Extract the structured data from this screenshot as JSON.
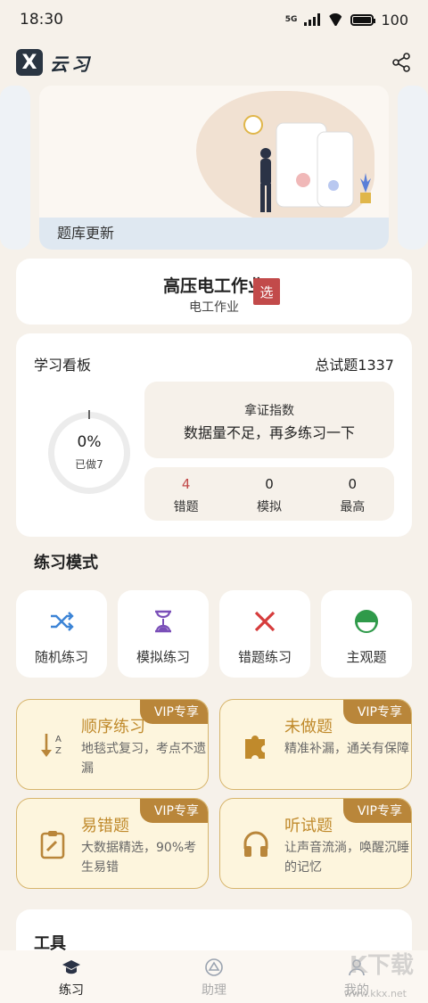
{
  "status_bar": {
    "time": "18:30",
    "network": "5G",
    "battery": "100"
  },
  "header": {
    "brand": "云习",
    "logo_letter": "X",
    "share_icon": "share-icon"
  },
  "banner": {
    "title": "题库更新"
  },
  "course": {
    "title": "高压电工作业",
    "subtitle": "电工作业",
    "select_badge": "选"
  },
  "board": {
    "title": "学习看板",
    "total": "总试题1337",
    "progress_percent": "0%",
    "done": "已做7",
    "index_label": "拿证指数",
    "index_message": "数据量不足，再多练习一下",
    "stats": [
      {
        "value": "4",
        "label": "错题",
        "color": "#c24a4a"
      },
      {
        "value": "0",
        "label": "模拟",
        "color": "#222222"
      },
      {
        "value": "0",
        "label": "最高",
        "color": "#222222"
      }
    ]
  },
  "practice": {
    "title": "练习模式",
    "modes": [
      {
        "label": "随机练习",
        "icon": "shuffle-icon"
      },
      {
        "label": "模拟练习",
        "icon": "hourglass-icon"
      },
      {
        "label": "错题练习",
        "icon": "close-icon"
      },
      {
        "label": "主观题",
        "icon": "half-circle-icon"
      }
    ],
    "vip_cards": [
      {
        "tag": "VIP专享",
        "title": "顺序练习",
        "desc": "地毯式复习，考点不遗漏",
        "icon": "sort-az-icon"
      },
      {
        "tag": "VIP专享",
        "title": "未做题",
        "desc": "精准补漏，通关有保障",
        "icon": "puzzle-icon"
      },
      {
        "tag": "VIP专享",
        "title": "易错题",
        "desc": "大数据精选，90%考生易错",
        "icon": "clipboard-edit-icon"
      },
      {
        "tag": "VIP专享",
        "title": "听试题",
        "desc": "让声音流淌，唤醒沉睡的记忆",
        "icon": "headphones-icon"
      }
    ]
  },
  "tools": {
    "title": "工具"
  },
  "nav": {
    "items": [
      {
        "label": "练习",
        "icon": "graduation-cap-icon",
        "active": true
      },
      {
        "label": "助理",
        "icon": "assistant-icon",
        "active": false
      },
      {
        "label": "我的",
        "icon": "user-icon",
        "active": false
      }
    ]
  },
  "watermark": {
    "text": "K下载",
    "url": "www.kkx.net"
  },
  "colors": {
    "accent_red": "#c24a4a",
    "vip_gold": "#c08a2c",
    "background": "#f6f1ea"
  }
}
